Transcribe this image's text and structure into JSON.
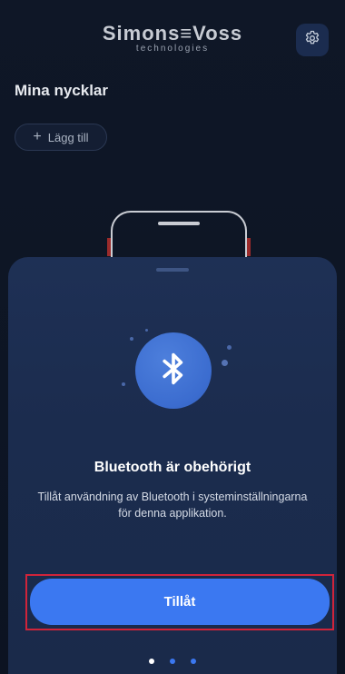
{
  "header": {
    "logo_main": "Simons≡Voss",
    "logo_sub": "technologies",
    "settings_icon": "gear-icon"
  },
  "main": {
    "title": "Mina nycklar",
    "add_button": {
      "icon": "plus-icon",
      "label": "Lägg till"
    }
  },
  "sheet": {
    "icon": "bluetooth-icon",
    "title": "Bluetooth är obehörigt",
    "description": "Tillåt användning av Bluetooth i systeminställningarna för denna applikation.",
    "button_label": "Tillåt",
    "pager": {
      "count": 3,
      "active_index": 0
    }
  },
  "colors": {
    "background": "#0f1727",
    "sheet": "#1e3055",
    "accent": "#3b78f1",
    "highlight_outline": "#d0243a"
  }
}
